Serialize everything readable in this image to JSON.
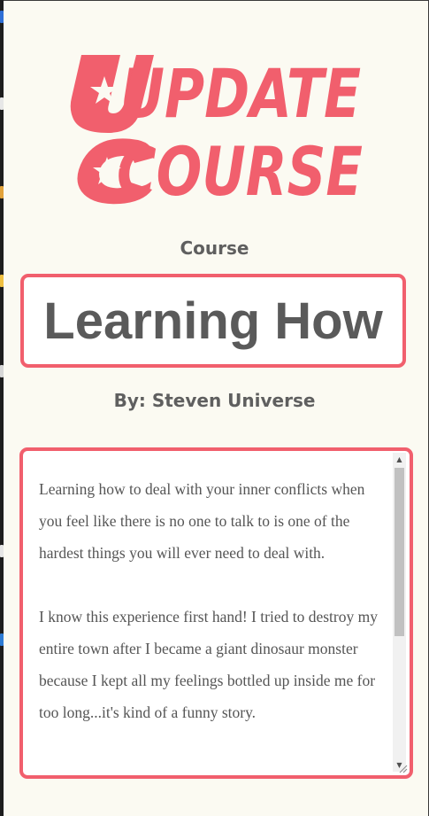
{
  "page": {
    "title_line1": "UPDATE",
    "title_line2": "COURSE",
    "course_label": "Course",
    "course_value": "Learning How",
    "byline": "By: Steven Universe",
    "description_paragraphs": [
      "Learning how to deal with your inner conflicts when you feel like there is no one to talk to is one of the hardest things you will ever need to deal with.",
      "I know this experience first hand! I tried to destroy my entire town after I became a giant dinosaur monster because I kept all my feelings bottled up inside me for too long...it's kind of a funny story."
    ]
  },
  "colors": {
    "background": "#fbfaf2",
    "accent": "#f15f6d",
    "text": "#5f5f5f"
  },
  "icons": {
    "title_star": "star-icon",
    "scroll_up": "up-arrow-icon",
    "scroll_down": "down-arrow-icon",
    "resize": "resize-grip-icon"
  }
}
